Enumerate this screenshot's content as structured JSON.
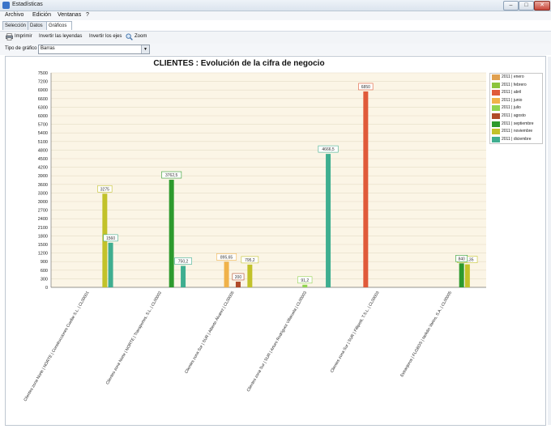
{
  "window": {
    "title": "Estadísticas",
    "btn_min": "–",
    "btn_max": "□",
    "btn_close": "✕"
  },
  "menu": [
    "Archivo",
    "Edición",
    "Ventanas",
    "?"
  ],
  "tabs": [
    "Selección",
    "Datos",
    "Gráficos"
  ],
  "toolbar": {
    "print": "Imprimir",
    "invert_legends": "Invertir las leyendas",
    "invert_axes": "Invertir los ejes",
    "zoom": "Zoom"
  },
  "chart_type": {
    "label": "Tipo de gráfico",
    "value": "Barras"
  },
  "icons": {
    "print": "printer-icon",
    "zoom": "magnifier-icon"
  },
  "chart_data": {
    "type": "bar",
    "title": "CLIENTES : Evolución de la cifra de negocio",
    "ylim": [
      0,
      7500
    ],
    "yticks": [
      0,
      300,
      600,
      900,
      1200,
      1500,
      1800,
      2100,
      2400,
      2700,
      3000,
      3300,
      3600,
      3900,
      4200,
      4500,
      4800,
      5100,
      5400,
      5700,
      6000,
      6300,
      6600,
      6900,
      7200,
      7500
    ],
    "categories": [
      "Clientes zona Norte | NORTE | Construcciones Cuellar S.L. | CL00001",
      "Clientes zona Norte | NORTE | Transportes, S.L. | CL00002",
      "Clientes zona Sur | SUR | Alberto Álvarez | CL00005",
      "Clientes zona Sur | SUR | Arturo Rodríguez Villaruela | CL00003",
      "Clientes zona Sur | SUR | Fillipetti, T.S.L. | CL00003",
      "Extranjeros | FLGBOS | Nefelin Varios, S.A. | CL00005"
    ],
    "series": [
      {
        "name": "2011 | enero",
        "color": "#e0a050",
        "values": [
          null,
          null,
          null,
          null,
          null,
          null
        ]
      },
      {
        "name": "2011 | febrero",
        "color": "#8cc43c",
        "values": [
          null,
          null,
          null,
          null,
          null,
          null
        ]
      },
      {
        "name": "2011 | abril",
        "color": "#e05a3a",
        "values": [
          null,
          null,
          null,
          null,
          6850,
          null
        ]
      },
      {
        "name": "2011 | junio",
        "color": "#f0b24a",
        "values": [
          null,
          null,
          895.65,
          null,
          null,
          null
        ]
      },
      {
        "name": "2011 | julio",
        "color": "#90d450",
        "values": [
          null,
          null,
          null,
          91.2,
          null,
          null
        ]
      },
      {
        "name": "2011 | agosto",
        "color": "#b04a28",
        "values": [
          null,
          null,
          200,
          null,
          null,
          null
        ]
      },
      {
        "name": "2011 | septiembre",
        "color": "#2d9a2d",
        "values": [
          null,
          3762.5,
          null,
          null,
          null,
          840
        ]
      },
      {
        "name": "2011 | noviembre",
        "color": "#c2c22a",
        "values": [
          3275,
          null,
          795.2,
          null,
          null,
          804.35
        ]
      },
      {
        "name": "2011 | diciembre",
        "color": "#3fae90",
        "values": [
          1560,
          750.2,
          null,
          4666.5,
          null,
          null
        ]
      }
    ],
    "bars": [
      {
        "cat": 0,
        "series": 7,
        "value": 3275,
        "label": "3275"
      },
      {
        "cat": 0,
        "series": 8,
        "value": 1560,
        "label": "1560"
      },
      {
        "cat": 1,
        "series": 6,
        "value": 3762.5,
        "label": "3762,5"
      },
      {
        "cat": 1,
        "series": 8,
        "value": 750.2,
        "label": "750,2"
      },
      {
        "cat": 2,
        "series": 3,
        "value": 895.65,
        "label": "895,65"
      },
      {
        "cat": 2,
        "series": 7,
        "value": 795.2,
        "label": "795,2"
      },
      {
        "cat": 2,
        "series": 5,
        "value": 200,
        "label": "200"
      },
      {
        "cat": 3,
        "series": 4,
        "value": 91.2,
        "label": "91,2"
      },
      {
        "cat": 3,
        "series": 8,
        "value": 4666.5,
        "label": "4666,5"
      },
      {
        "cat": 4,
        "series": 2,
        "value": 6850,
        "label": "6850"
      },
      {
        "cat": 5,
        "series": 7,
        "value": 804.35,
        "label": "804,35"
      },
      {
        "cat": 5,
        "series": 6,
        "value": 840,
        "label": "840"
      }
    ],
    "legend_position": "right",
    "grid": true
  }
}
